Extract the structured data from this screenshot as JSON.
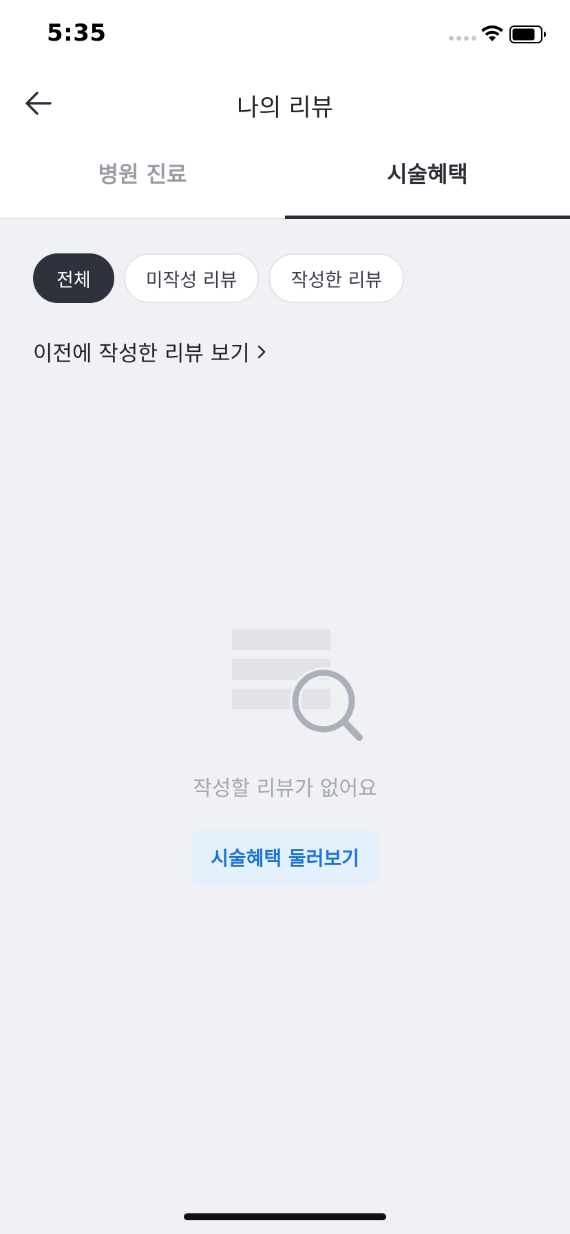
{
  "status_bar": {
    "time": "5:35"
  },
  "header": {
    "title": "나의 리뷰",
    "back_icon": "arrow-left-icon"
  },
  "tabs": [
    {
      "label": "병원 진료",
      "active": false
    },
    {
      "label": "시술혜택",
      "active": true
    }
  ],
  "filters": [
    {
      "label": "전체",
      "selected": true
    },
    {
      "label": "미작성 리뷰",
      "selected": false
    },
    {
      "label": "작성한 리뷰",
      "selected": false
    }
  ],
  "previous_reviews_link": {
    "label": "이전에 작성한 리뷰 보기",
    "icon": "chevron-right-icon"
  },
  "empty_state": {
    "icon": "document-search-icon",
    "message": "작성할 리뷰가 없어요",
    "button_label": "시술혜택 둘러보기"
  },
  "colors": {
    "background": "#f0f1f5",
    "active_tab": "#2b2e38",
    "inactive_tab": "#9a9ca5",
    "selected_chip": "#2e323d",
    "accent_blue": "#1a74d6",
    "button_bg": "#e4f0fc"
  }
}
